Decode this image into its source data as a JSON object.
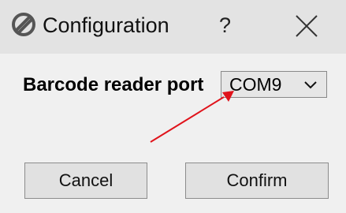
{
  "window": {
    "title": "Configuration",
    "help_label": "?",
    "app_icon": "no-entry-circle-icon",
    "close_icon": "close-icon"
  },
  "form": {
    "port_label": "Barcode reader port",
    "port_select": {
      "value": "COM9",
      "icon": "chevron-down-icon"
    }
  },
  "buttons": {
    "cancel_label": "Cancel",
    "confirm_label": "Confirm"
  },
  "annotation": {
    "arrow_color": "#e0131b"
  }
}
